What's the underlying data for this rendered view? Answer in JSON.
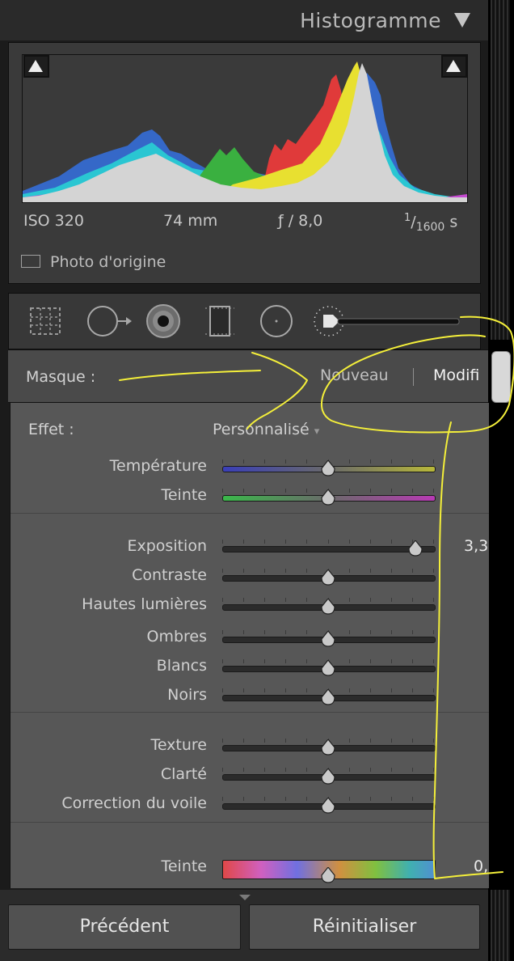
{
  "histogram": {
    "title": "Histogramme",
    "iso": "ISO 320",
    "focal": "74 mm",
    "aperture": "ƒ / 8,0",
    "shutter_num": "1",
    "shutter_den": "1600",
    "shutter_unit": "s",
    "original_photo_label": "Photo d'origine"
  },
  "mask": {
    "label": "Masque :",
    "new_label": "Nouveau",
    "edit_label": "Modifi"
  },
  "effect": {
    "label": "Effet :",
    "value": "Personnalisé"
  },
  "sliders": [
    {
      "label": "Température",
      "value": 0,
      "range": [
        -100,
        100
      ],
      "style": "temp"
    },
    {
      "label": "Teinte",
      "value": 0,
      "range": [
        -100,
        100
      ],
      "style": "tint"
    },
    {
      "label": "Exposition",
      "value": 3.3,
      "display": "3,3",
      "range": [
        -4,
        4
      ],
      "style": "plain"
    },
    {
      "label": "Contraste",
      "value": 0,
      "range": [
        -100,
        100
      ],
      "style": "plain"
    },
    {
      "label": "Hautes lumières",
      "value": 0,
      "range": [
        -100,
        100
      ],
      "style": "plain"
    },
    {
      "label": "Ombres",
      "value": 0,
      "range": [
        -100,
        100
      ],
      "style": "plain"
    },
    {
      "label": "Blancs",
      "value": 0,
      "range": [
        -100,
        100
      ],
      "style": "plain"
    },
    {
      "label": "Noirs",
      "value": 0,
      "range": [
        -100,
        100
      ],
      "style": "plain"
    },
    {
      "label": "Texture",
      "value": 0,
      "range": [
        -100,
        100
      ],
      "style": "plain"
    },
    {
      "label": "Clarté",
      "value": 0,
      "range": [
        -100,
        100
      ],
      "style": "plain"
    },
    {
      "label": "Correction du voile",
      "value": 0,
      "range": [
        -100,
        100
      ],
      "style": "plain"
    },
    {
      "label": "Teinte",
      "value": 0,
      "display": "0,",
      "range": [
        -100,
        100
      ],
      "style": "hue"
    }
  ],
  "buttons": {
    "previous": "Précédent",
    "reset": "Réinitialiser"
  },
  "tools": [
    "crop-overlay-icon",
    "spot-removal-icon",
    "red-eye-icon",
    "graduated-filter-icon",
    "radial-filter-icon",
    "adjustment-brush-icon"
  ],
  "colors": {
    "panel": "#575757",
    "annotation": "#f4ef3a"
  }
}
